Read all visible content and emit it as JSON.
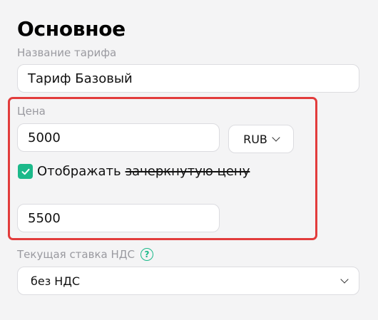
{
  "section": {
    "title": "Основное"
  },
  "tariff": {
    "name_label": "Название тарифа",
    "name_value": "Тариф Базовый"
  },
  "price": {
    "label": "Цена",
    "value": "5000",
    "currency": "RUB",
    "show_crossed_label": "Отображать",
    "show_crossed_struck_label": "зачеркнутую цену",
    "show_crossed_checked": true,
    "crossed_value": "5500"
  },
  "vat": {
    "label": "Текущая ставка НДС",
    "help_symbol": "?",
    "value": "без НДС"
  },
  "colors": {
    "accent": "#1cb98a",
    "highlight": "#e23c3c",
    "background": "#f4f4f5"
  }
}
